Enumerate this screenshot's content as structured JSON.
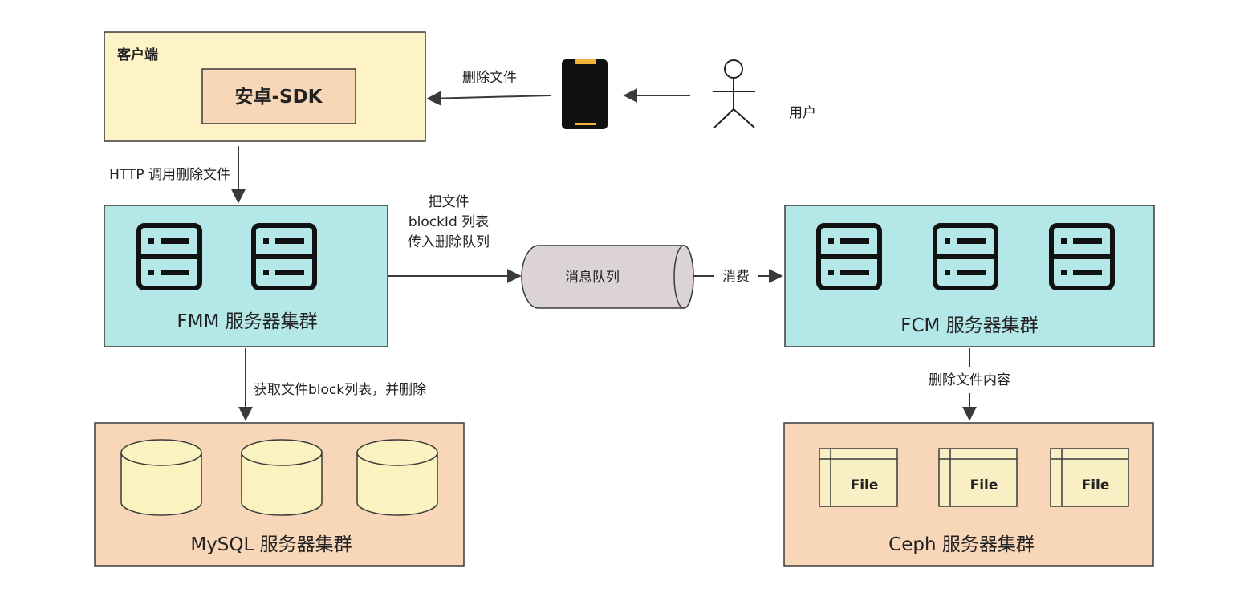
{
  "colors": {
    "client_fill": "#fdf3c6",
    "sdk_fill": "#f8d7b8",
    "server_fill": "#b4e7e8",
    "storage_fill": "#f8d7b8",
    "queue_fill": "#dcd4d4",
    "cylinder_fill": "#fbf3bf",
    "file_fill": "#f8f0c4",
    "stroke": "#3a3a3a",
    "phone_body": "#111111",
    "phone_accent": "#f0b43c"
  },
  "client": {
    "title": "客户端",
    "sdk_label": "安卓-SDK"
  },
  "user": {
    "label": "用户"
  },
  "edges": {
    "phone_to_client": "删除文件",
    "client_to_fmm": "HTTP 调用删除文件",
    "fmm_to_queue": [
      "把文件",
      "blockId 列表",
      "传入删除队列"
    ],
    "queue_to_fcm": "消费",
    "fmm_to_mysql": "获取文件block列表，并删除",
    "fcm_to_ceph": "删除文件内容"
  },
  "fmm": {
    "label": "FMM 服务器集群",
    "icons": [
      "server-icon",
      "server-icon"
    ]
  },
  "fcm": {
    "label": "FCM 服务器集群",
    "icons": [
      "server-icon",
      "server-icon",
      "server-icon"
    ]
  },
  "queue": {
    "label": "消息队列"
  },
  "mysql": {
    "label": "MySQL 服务器集群",
    "icons": [
      "database-icon",
      "database-icon",
      "database-icon"
    ]
  },
  "ceph": {
    "label": "Ceph 服务器集群",
    "files": [
      "File",
      "File",
      "File"
    ]
  }
}
